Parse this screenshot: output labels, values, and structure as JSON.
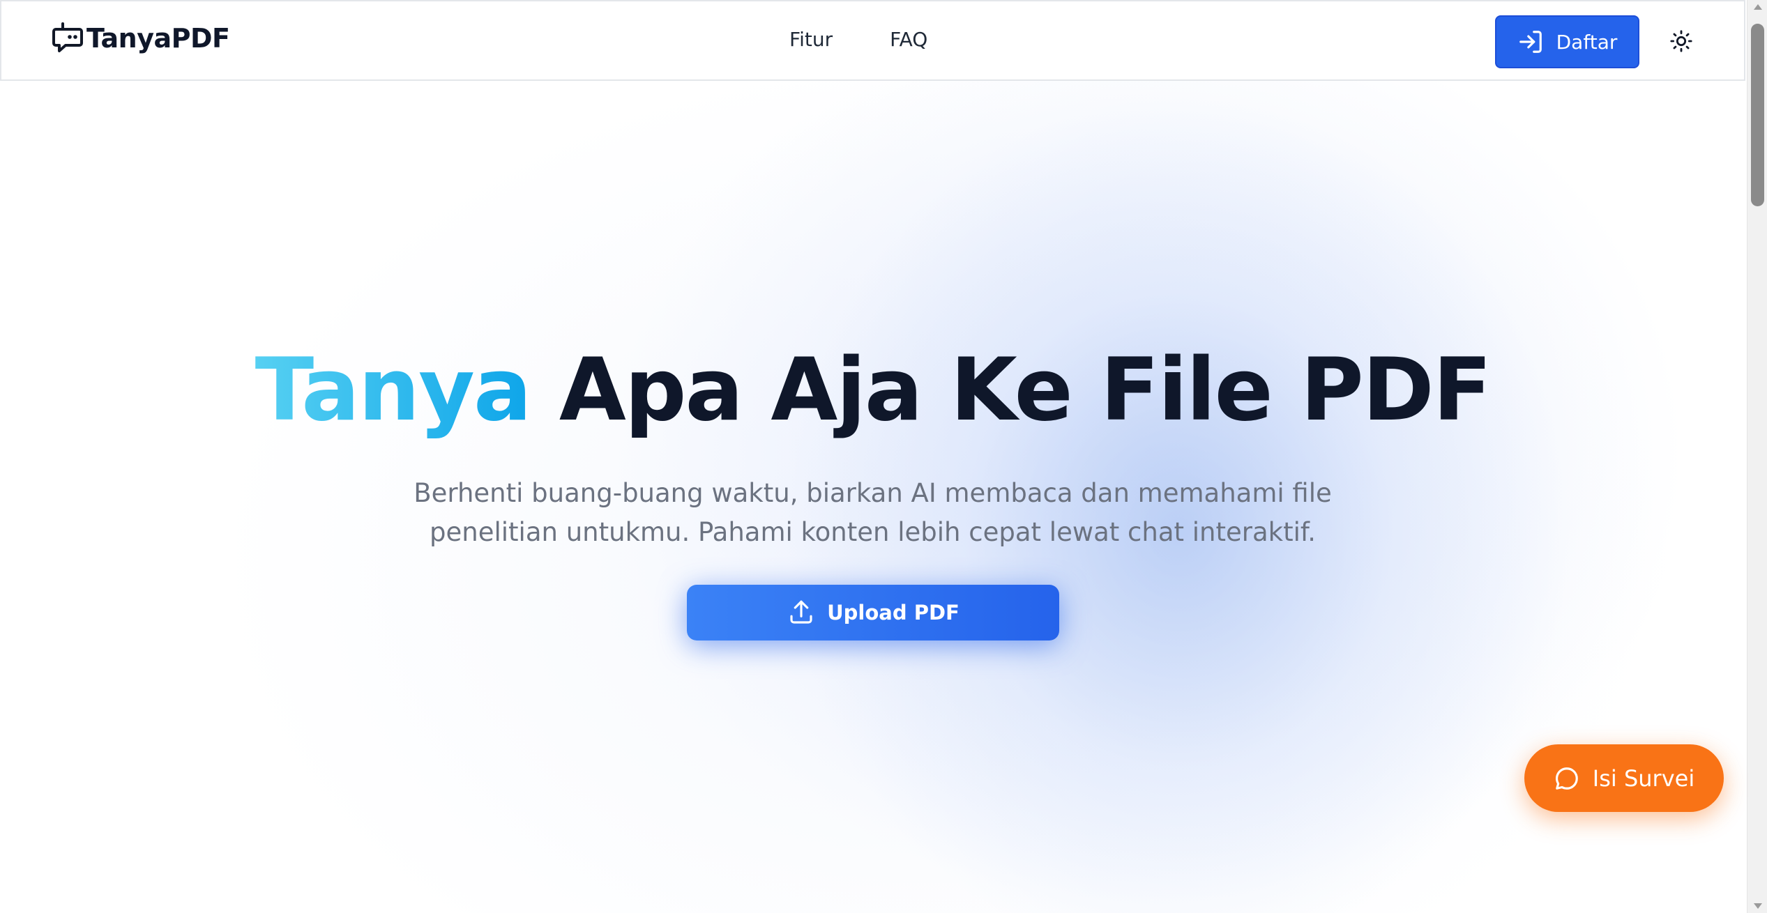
{
  "header": {
    "logo_text": "TanyaPDF",
    "nav": [
      {
        "label": "Fitur"
      },
      {
        "label": "FAQ"
      }
    ],
    "signup_label": "Daftar",
    "signup_icon": "login-arrow-icon",
    "theme_icon": "sun-icon"
  },
  "hero": {
    "headline_accent": "Tanya",
    "headline_rest": " Apa Aja Ke File PDF",
    "subtitle": "Berhenti buang-buang waktu, biarkan AI membaca dan memahami file penelitian untukmu. Pahami konten lebih cepat lewat chat interaktif.",
    "upload_label": "Upload PDF",
    "upload_icon": "upload-icon"
  },
  "survey": {
    "label": "Isi Survei",
    "icon": "chat-bubble-icon"
  },
  "colors": {
    "primary": "#2563eb",
    "accent_gradient_start": "#56d0f2",
    "accent_gradient_end": "#0ea5e9",
    "survey_orange": "#f97316",
    "text_dark": "#0f172a",
    "text_muted": "#6b7280"
  }
}
